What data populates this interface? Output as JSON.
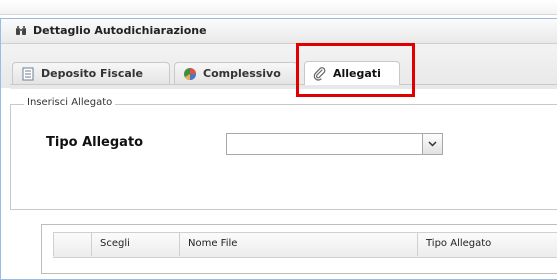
{
  "panel": {
    "title": "Dettaglio Autodichiarazione",
    "icon": "binoculars-icon"
  },
  "tabs": [
    {
      "label": "Deposito Fiscale",
      "icon": "document-icon",
      "active": false
    },
    {
      "label": "Complessivo",
      "icon": "pie-chart-icon",
      "active": false
    },
    {
      "label": "Allegati",
      "icon": "paperclip-icon",
      "active": true
    }
  ],
  "highlight_color": "#e00000",
  "form": {
    "legend": "Inserisci Allegato",
    "tipo_label": "Tipo Allegato",
    "tipo_value": ""
  },
  "grid": {
    "columns": [
      "",
      "Scegli",
      "Nome File",
      "Tipo Allegato"
    ]
  }
}
